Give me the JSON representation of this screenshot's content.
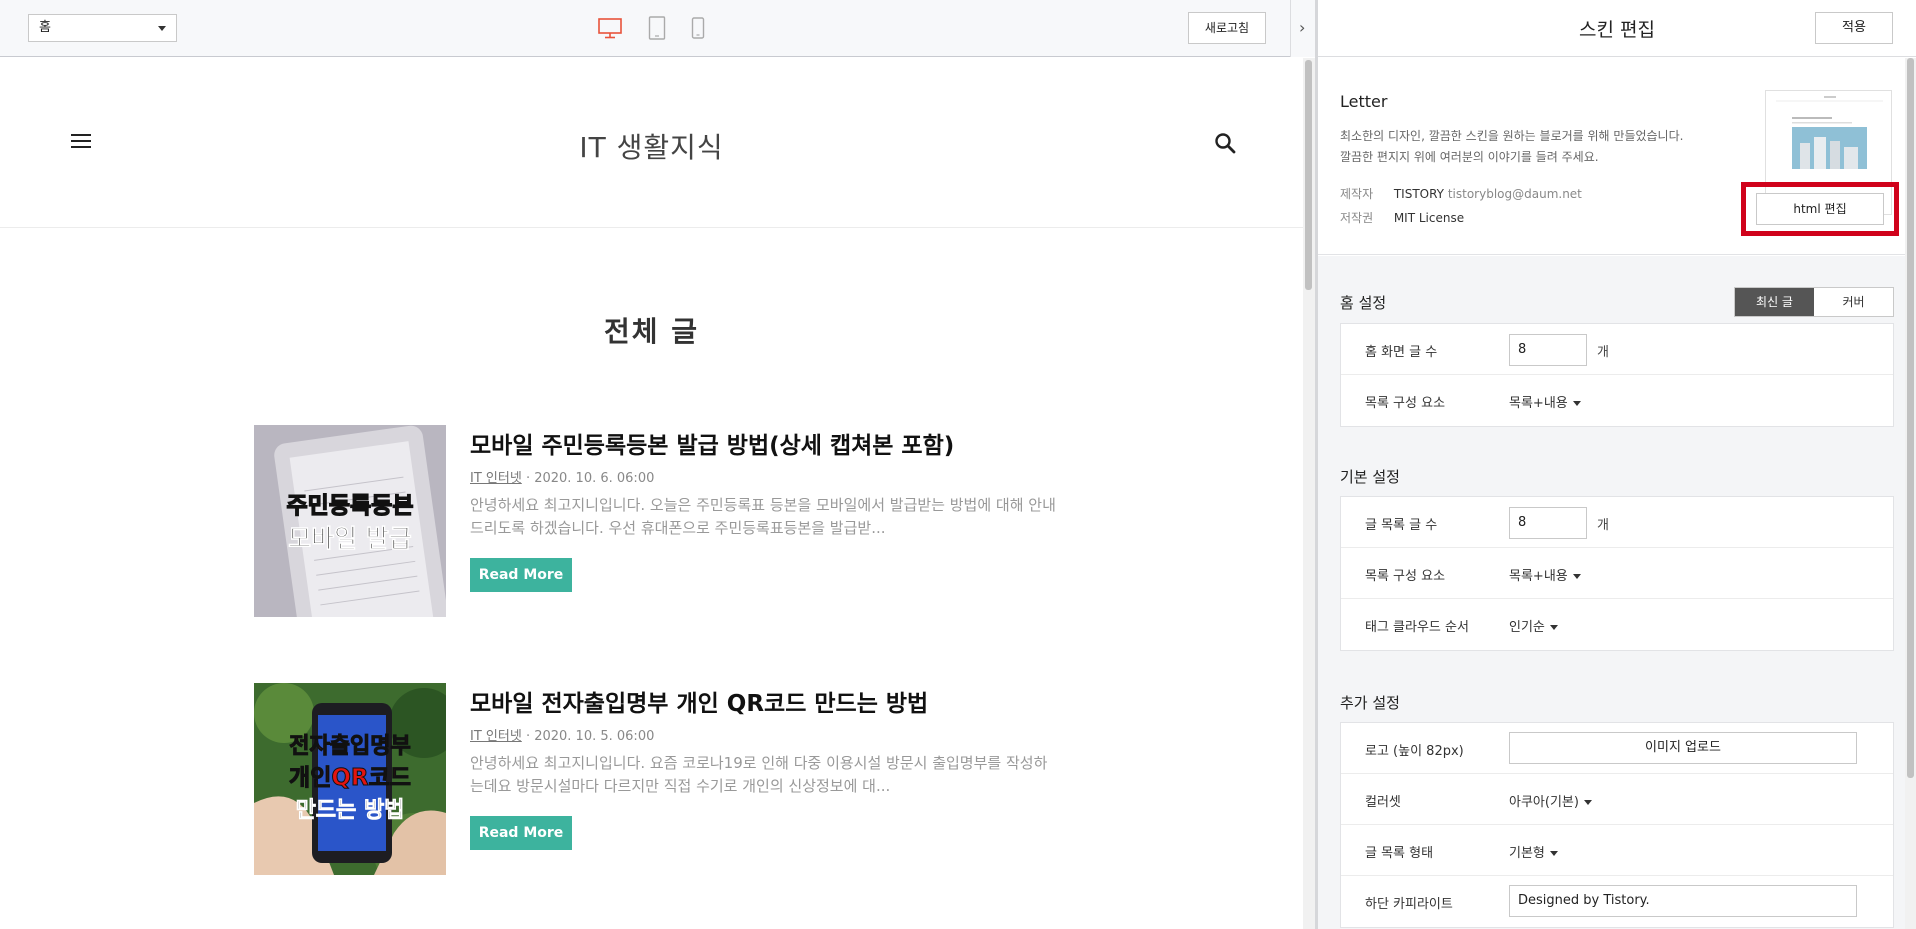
{
  "topbar": {
    "page_select": "홈",
    "refresh_label": "새로고침",
    "active_device_color": "#e8533b",
    "collapse_icon": "›"
  },
  "blog": {
    "title": "IT 생활지식",
    "section_title": "전체 글",
    "posts": [
      {
        "title": "모바일 주민등록등본 발급 방법(상세 캡쳐본 포함)",
        "category": "IT 인터넷",
        "date": "· 2020. 10. 6. 06:00",
        "excerpt": "안녕하세요 최고지니입니다. 오늘은 주민등록표 등본을 모바일에서 발급받는 방법에 대해 안내드리도록 하겠습니다. 우선 휴대폰으로 주민등록표등본을 발급받...",
        "thumb_text": [
          "주민등록등본",
          "모바일 발급"
        ],
        "read_more": "Read More"
      },
      {
        "title": "모바일 전자출입명부 개인 QR코드 만드는 방법",
        "category": "IT 인터넷",
        "date": "· 2020. 10. 5. 06:00",
        "excerpt": "안녕하세요 최고지니입니다. 요즘 코로나19로 인해 다중 이용시설 방문시 출입명부를 작성하는데요 방문시설마다 다르지만 직접 수기로 개인의 신상정보에 대...",
        "thumb_text": [
          "전자출입명부",
          "개인QR코드",
          "만드는 방법"
        ],
        "read_more": "Read More"
      }
    ],
    "accent_color": "#3db39e"
  },
  "panel": {
    "title": "스킨 편집",
    "apply_label": "적용",
    "skin": {
      "name": "Letter",
      "desc_line1": "최소한의 디자인, 깔끔한 스킨을 원하는 블로거를 위해 만들었습니다.",
      "desc_line2": "깔끔한 편지지 위에 여러분의 이야기를 들려 주세요.",
      "maker_key": "제작자",
      "maker_value": "TISTORY",
      "maker_mail": "tistoryblog@daum.net",
      "license_key": "저작권",
      "license_value": "MIT License",
      "html_edit_label": "html 편집",
      "highlight_color": "#d0021b"
    },
    "home": {
      "title": "홈 설정",
      "toggle_on": "최신 글",
      "toggle_off": "커버",
      "post_count_label": "홈 화면 글 수",
      "post_count_value": "8",
      "unit": "개",
      "list_comp_label": "목록 구성 요소",
      "list_comp_value": "목록+내용"
    },
    "basic": {
      "title": "기본 설정",
      "list_count_label": "글 목록 글 수",
      "list_count_value": "8",
      "unit": "개",
      "list_comp_label": "목록 구성 요소",
      "list_comp_value": "목록+내용",
      "tag_order_label": "태그 클라우드 순서",
      "tag_order_value": "인기순"
    },
    "extra": {
      "title": "추가 설정",
      "logo_label": "로고 (높이 82px)",
      "logo_button": "이미지 업로드",
      "colorset_label": "컬러셋",
      "colorset_value": "아쿠아(기본)",
      "list_type_label": "글 목록 형태",
      "list_type_value": "기본형",
      "copyright_label": "하단 카피라이트",
      "copyright_value": "Designed by Tistory."
    }
  }
}
